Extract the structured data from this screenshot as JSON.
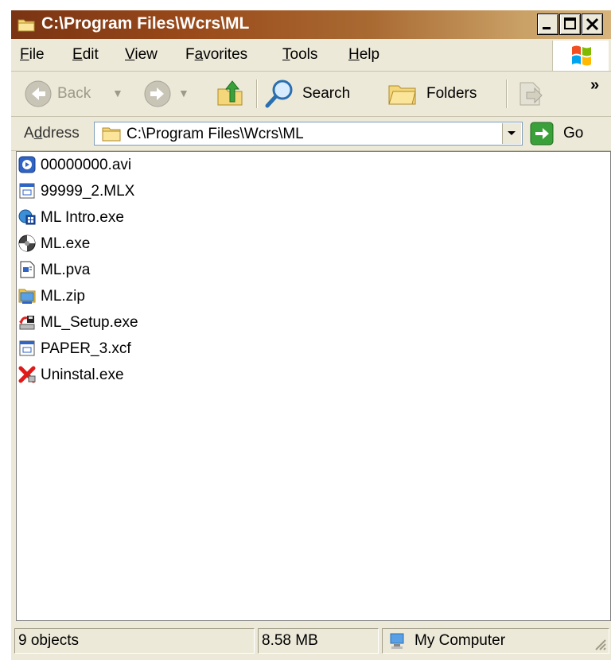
{
  "window": {
    "title": "C:\\Program Files\\Wcrs\\ML"
  },
  "menubar": {
    "items": [
      {
        "label": "File",
        "accel": "F"
      },
      {
        "label": "Edit",
        "accel": "E"
      },
      {
        "label": "View",
        "accel": "V"
      },
      {
        "label": "Favorites",
        "accel": "a"
      },
      {
        "label": "Tools",
        "accel": "T"
      },
      {
        "label": "Help",
        "accel": "H"
      }
    ]
  },
  "toolbar": {
    "back_label": "Back",
    "search_label": "Search",
    "folders_label": "Folders",
    "overflow": "»"
  },
  "address": {
    "label": "Address",
    "value": "C:\\Program Files\\Wcrs\\ML",
    "go_label": "Go"
  },
  "files": [
    {
      "name": "00000000.avi",
      "icon": "media-file-icon"
    },
    {
      "name": "99999_2.MLX",
      "icon": "generic-window-file-icon"
    },
    {
      "name": "ML Intro.exe",
      "icon": "application-exe-icon"
    },
    {
      "name": "ML.exe",
      "icon": "disc-exe-icon"
    },
    {
      "name": "ML.pva",
      "icon": "document-file-icon"
    },
    {
      "name": "ML.zip",
      "icon": "zip-folder-icon"
    },
    {
      "name": "ML_Setup.exe",
      "icon": "setup-installer-icon"
    },
    {
      "name": "PAPER_3.xcf",
      "icon": "generic-window-file-icon"
    },
    {
      "name": "Uninstal.exe",
      "icon": "uninstall-x-icon"
    }
  ],
  "status": {
    "objects": "9 objects",
    "size": "8.58 MB",
    "zone": "My Computer"
  },
  "colors": {
    "title_start": "#7a3413",
    "title_end": "#d6b47c",
    "chrome": "#ece9d8"
  }
}
